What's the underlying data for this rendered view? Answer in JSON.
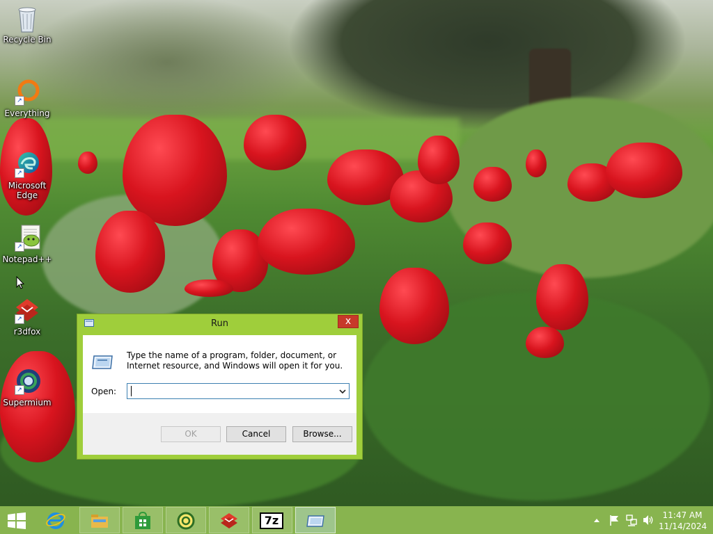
{
  "desktop": {
    "icons": [
      {
        "label": "Recycle Bin",
        "icon": "recycle-bin-icon"
      },
      {
        "label": "Everything",
        "icon": "everything-search-icon"
      },
      {
        "label": "Microsoft Edge",
        "icon": "edge-icon"
      },
      {
        "label": "Notepad++",
        "icon": "notepad-plus-plus-icon"
      },
      {
        "label": "r3dfox",
        "icon": "r3dfox-icon"
      },
      {
        "label": "Supermium",
        "icon": "supermium-icon"
      }
    ]
  },
  "run_dialog": {
    "title": "Run",
    "close_glyph": "x",
    "description": "Type the name of a program, folder, document, or Internet resource, and Windows will open it for you.",
    "open_label": "Open:",
    "open_value": "",
    "ok_label": "OK",
    "cancel_label": "Cancel",
    "browse_label": "Browse...",
    "ok_enabled": false
  },
  "taskbar": {
    "items": [
      {
        "name": "Internet Explorer",
        "icon": "internet-explorer-icon",
        "state": "unpinned"
      },
      {
        "name": "File Explorer",
        "icon": "file-explorer-icon",
        "state": "pinned"
      },
      {
        "name": "Store",
        "icon": "store-icon",
        "state": "pinned"
      },
      {
        "name": "Everything",
        "icon": "everything-icon",
        "state": "pinned"
      },
      {
        "name": "r3dfox",
        "icon": "r3dfox-icon",
        "state": "pinned"
      },
      {
        "name": "7-Zip",
        "icon": "7zip-icon",
        "state": "pinned"
      },
      {
        "name": "Run",
        "icon": "run-icon",
        "state": "active"
      }
    ],
    "zip_label": "7z",
    "clock": {
      "time": "11:47 AM",
      "date": "11/14/2024"
    }
  },
  "colors": {
    "window_frame": "#9fce3b",
    "taskbar": "#78aa37",
    "close_button": "#c7392a",
    "input_border": "#3c7fb1"
  }
}
